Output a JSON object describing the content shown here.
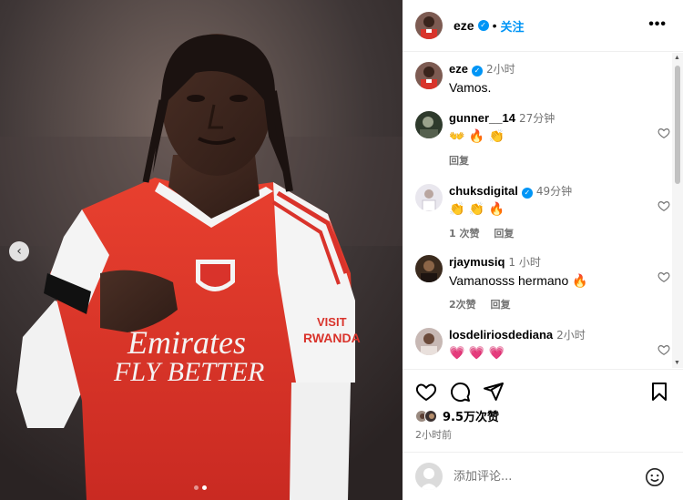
{
  "header": {
    "username": "eze",
    "separator": "•",
    "follow_label": "关注",
    "more_label": "•••"
  },
  "photo": {
    "shirt_sponsor_line1": "Emirates",
    "shirt_sponsor_line2": "FLY BETTER",
    "sleeve_text_line1": "VISIT",
    "sleeve_text_line2": "RWANDA",
    "slide_count": 2,
    "active_slide": 2,
    "prev_icon": "chevron-left-icon"
  },
  "caption": {
    "username": "eze",
    "time": "2小时",
    "text": "Vamos."
  },
  "comments": [
    {
      "username": "gunner__14",
      "verified": false,
      "time": "27分钟",
      "text": "👐 🔥 👏",
      "like_count_label": "",
      "reply_label": "回复"
    },
    {
      "username": "chuksdigital",
      "verified": true,
      "time": "49分钟",
      "text": "👏 👏 🔥",
      "like_count_label": "1 次赞",
      "reply_label": "回复"
    },
    {
      "username": "rjaymusiq",
      "verified": false,
      "time": "1 小时",
      "text": "Vamanosss hermano 🔥",
      "like_count_label": "2次赞",
      "reply_label": "回复"
    },
    {
      "username": "losdeliriosdediana",
      "verified": false,
      "time": "2小时",
      "text": "💗 💗 💗",
      "like_count_label": "",
      "reply_label": ""
    }
  ],
  "post": {
    "likes": "9.5万次赞",
    "time": "2小时前"
  },
  "add_comment": {
    "placeholder": "添加评论..."
  },
  "colors": {
    "accent": "#0095f6",
    "arsenal_red": "#e0312a",
    "muted": "#737373"
  }
}
